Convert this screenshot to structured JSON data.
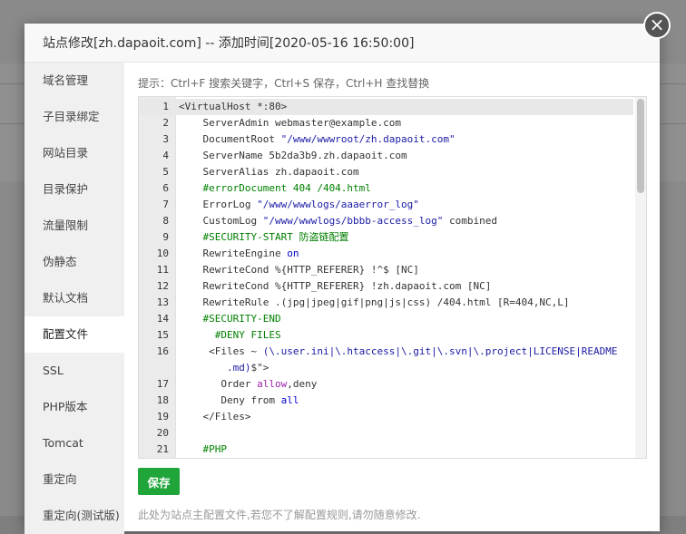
{
  "modal": {
    "title": "站点修改[zh.dapaoit.com] -- 添加时间[2020-05-16 16:50:00]",
    "close_label": "×"
  },
  "sidebar": {
    "items": [
      {
        "label": "域名管理"
      },
      {
        "label": "子目录绑定"
      },
      {
        "label": "网站目录"
      },
      {
        "label": "目录保护"
      },
      {
        "label": "流量限制"
      },
      {
        "label": "伪静态"
      },
      {
        "label": "默认文档"
      },
      {
        "label": "配置文件"
      },
      {
        "label": "SSL"
      },
      {
        "label": "PHP版本"
      },
      {
        "label": "Tomcat"
      },
      {
        "label": "重定向"
      },
      {
        "label": "重定向(测试版)"
      }
    ],
    "active_index": 7
  },
  "editor": {
    "tip": "提示：Ctrl+F 搜索关键字，Ctrl+S 保存，Ctrl+H 查找替换",
    "lines": [
      {
        "n": "1",
        "segs": [
          {
            "t": "<VirtualHost *:80>",
            "c": ""
          }
        ]
      },
      {
        "n": "2",
        "segs": [
          {
            "t": "    ServerAdmin webmaster@example.com",
            "c": ""
          }
        ]
      },
      {
        "n": "3",
        "segs": [
          {
            "t": "    DocumentRoot ",
            "c": ""
          },
          {
            "t": "\"/www/wwwroot/zh.dapaoit.com\"",
            "c": "c-str"
          }
        ]
      },
      {
        "n": "4",
        "segs": [
          {
            "t": "    ServerName 5b2da3b9.zh.dapaoit.com",
            "c": ""
          }
        ]
      },
      {
        "n": "5",
        "segs": [
          {
            "t": "    ServerAlias zh.dapaoit.com",
            "c": ""
          }
        ]
      },
      {
        "n": "6",
        "segs": [
          {
            "t": "    #errorDocument 404 /404.html",
            "c": "c-cmt"
          }
        ]
      },
      {
        "n": "7",
        "segs": [
          {
            "t": "    ErrorLog ",
            "c": ""
          },
          {
            "t": "\"/www/wwwlogs/aaaerror_log\"",
            "c": "c-str"
          }
        ]
      },
      {
        "n": "8",
        "segs": [
          {
            "t": "    CustomLog ",
            "c": ""
          },
          {
            "t": "\"/www/wwwlogs/bbbb-access_log\"",
            "c": "c-str"
          },
          {
            "t": " combined",
            "c": ""
          }
        ]
      },
      {
        "n": "9",
        "segs": [
          {
            "t": "    #SECURITY-START 防盗链配置",
            "c": "c-cmt"
          }
        ]
      },
      {
        "n": "10",
        "segs": [
          {
            "t": "    RewriteEngine ",
            "c": ""
          },
          {
            "t": "on",
            "c": "c-kw"
          }
        ]
      },
      {
        "n": "11",
        "segs": [
          {
            "t": "    RewriteCond %{HTTP_REFERER} !^$ [NC]",
            "c": ""
          }
        ]
      },
      {
        "n": "12",
        "segs": [
          {
            "t": "    RewriteCond %{HTTP_REFERER} !zh.dapaoit.com [NC]",
            "c": ""
          }
        ]
      },
      {
        "n": "13",
        "segs": [
          {
            "t": "    RewriteRule .(jpg|jpeg|gif|png|js|css) /404.html [R=404,NC,L]",
            "c": ""
          }
        ]
      },
      {
        "n": "14",
        "segs": [
          {
            "t": "    #SECURITY-END",
            "c": "c-cmt"
          }
        ]
      },
      {
        "n": "15",
        "segs": [
          {
            "t": "      #DENY FILES",
            "c": "c-cmt"
          }
        ]
      },
      {
        "n": "16",
        "segs": [
          {
            "t": "     <Files ~ ",
            "c": ""
          },
          {
            "t": "(\\.user.ini|\\.htaccess|\\.git|\\.svn|\\.project|LICENSE|README",
            "c": "c-str"
          }
        ]
      },
      {
        "n": "",
        "segs": [
          {
            "t": "        .md)",
            "c": "c-str"
          },
          {
            "t": "$\">",
            "c": ""
          }
        ]
      },
      {
        "n": "17",
        "segs": [
          {
            "t": "       Order ",
            "c": ""
          },
          {
            "t": "allow",
            "c": "c-purple"
          },
          {
            "t": ",deny",
            "c": ""
          }
        ]
      },
      {
        "n": "18",
        "segs": [
          {
            "t": "       Deny from ",
            "c": ""
          },
          {
            "t": "all",
            "c": "c-kw"
          }
        ]
      },
      {
        "n": "19",
        "segs": [
          {
            "t": "    </Files>",
            "c": ""
          }
        ]
      },
      {
        "n": "20",
        "segs": [
          {
            "t": "",
            "c": ""
          }
        ]
      },
      {
        "n": "21",
        "segs": [
          {
            "t": "    #PHP",
            "c": "c-cmt"
          }
        ]
      }
    ]
  },
  "actions": {
    "save_label": "保存",
    "footnote": "此处为站点主配置文件,若您不了解配置规则,请勿随意修改."
  },
  "colors": {
    "accent": "#20a53a"
  }
}
